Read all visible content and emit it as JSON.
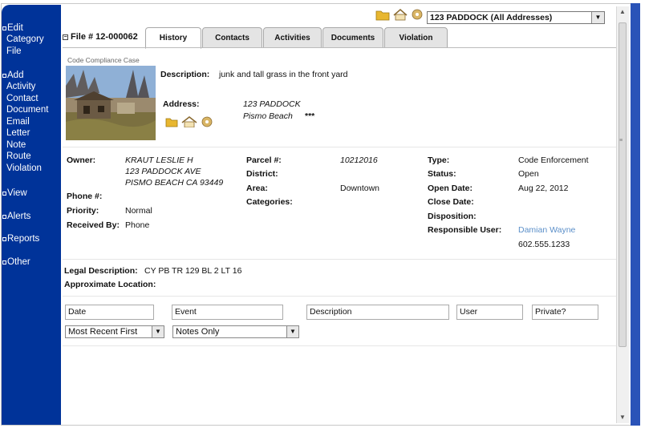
{
  "sidebar": {
    "groups": [
      {
        "head": "Edit",
        "items": [
          "Category",
          "File"
        ]
      },
      {
        "head": "Add",
        "items": [
          "Activity",
          "Contact",
          "Document",
          "Email",
          "Letter",
          "Note",
          "Route",
          "Violation"
        ]
      },
      {
        "head": "View",
        "items": []
      },
      {
        "head": "Alerts",
        "items": []
      },
      {
        "head": "Reports",
        "items": []
      },
      {
        "head": "Other",
        "items": []
      }
    ]
  },
  "header": {
    "file_label": "File # 12-000062",
    "address_select": "123 PADDOCK (All Addresses)",
    "tabs": [
      "History",
      "Contacts",
      "Activities",
      "Documents",
      "Violation"
    ]
  },
  "case": {
    "caption": "Code Compliance Case",
    "description_label": "Description:",
    "description": "junk and tall grass in the front yard",
    "address_label": "Address:",
    "address_line1": "123 PADDOCK",
    "address_line2": "Pismo Beach",
    "address_stars": "***"
  },
  "details": {
    "owner_label": "Owner:",
    "owner_name": "KRAUT LESLIE H",
    "owner_street": "123 PADDOCK AVE",
    "owner_city": "PISMO BEACH  CA  93449",
    "phone_label": "Phone #:",
    "priority_label": "Priority:",
    "priority": "Normal",
    "received_label": "Received By:",
    "received": "Phone",
    "parcel_label": "Parcel #:",
    "parcel": "10212016",
    "district_label": "District:",
    "area_label": "Area:",
    "area": "Downtown",
    "categories_label": "Categories:",
    "type_label": "Type:",
    "type": "Code Enforcement",
    "status_label": "Status:",
    "status": "Open",
    "open_date_label": "Open Date:",
    "open_date": "Aug 22, 2012",
    "close_date_label": "Close Date:",
    "disposition_label": "Disposition:",
    "resp_user_label": "Responsible User:",
    "resp_user": "Damian Wayne",
    "resp_phone": "602.555.1233"
  },
  "legal": {
    "legal_label": "Legal Description:",
    "legal": "CY PB TR 129 BL 2 LT 16",
    "approx_label": "Approximate Location:"
  },
  "history": {
    "columns": [
      "Date",
      "Event",
      "Description",
      "User",
      "Private?"
    ],
    "sort_select": "Most Recent First",
    "filter_select": "Notes Only"
  },
  "colors": {
    "sidebar": "#003399",
    "link": "#5b8fc9"
  }
}
